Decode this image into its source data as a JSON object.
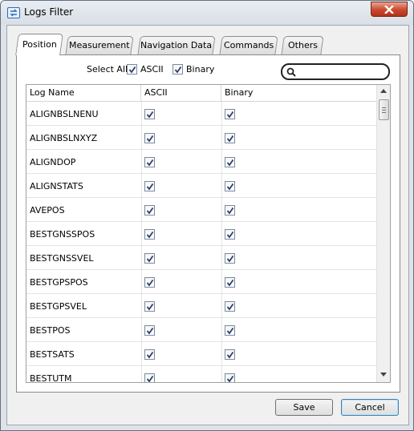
{
  "window": {
    "title": "Logs Filter"
  },
  "tabs": [
    {
      "label": "Position",
      "active": true
    },
    {
      "label": "Measurement",
      "active": false
    },
    {
      "label": "Navigation Data",
      "active": false
    },
    {
      "label": "Commands",
      "active": false
    },
    {
      "label": "Others",
      "active": false
    }
  ],
  "filter": {
    "select_all_label": "Select All",
    "ascii_label": "ASCII",
    "ascii_checked": true,
    "binary_label": "Binary",
    "binary_checked": true,
    "search_placeholder": "",
    "search_value": ""
  },
  "table": {
    "columns": [
      "Log Name",
      "ASCII",
      "Binary"
    ],
    "rows": [
      {
        "name": "ALIGNBSLNENU",
        "ascii": true,
        "binary": true
      },
      {
        "name": "ALIGNBSLNXYZ",
        "ascii": true,
        "binary": true
      },
      {
        "name": "ALIGNDOP",
        "ascii": true,
        "binary": true
      },
      {
        "name": "ALIGNSTATS",
        "ascii": true,
        "binary": true
      },
      {
        "name": "AVEPOS",
        "ascii": true,
        "binary": true
      },
      {
        "name": "BESTGNSSPOS",
        "ascii": true,
        "binary": true
      },
      {
        "name": "BESTGNSSVEL",
        "ascii": true,
        "binary": true
      },
      {
        "name": "BESTGPSPOS",
        "ascii": true,
        "binary": true
      },
      {
        "name": "BESTGPSVEL",
        "ascii": true,
        "binary": true
      },
      {
        "name": "BESTPOS",
        "ascii": true,
        "binary": true
      },
      {
        "name": "BESTSATS",
        "ascii": true,
        "binary": true
      },
      {
        "name": "BESTUTM",
        "ascii": true,
        "binary": true
      }
    ]
  },
  "buttons": {
    "save_label": "Save",
    "cancel_label": "Cancel"
  },
  "colors": {
    "title_bar": "#dfe3e8",
    "close_button": "#c9482d",
    "primary_button_border": "#3c7fb1"
  }
}
